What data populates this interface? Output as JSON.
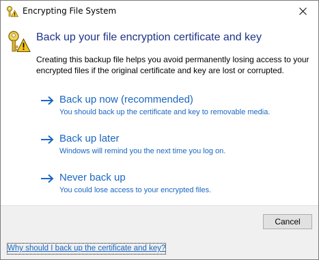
{
  "window": {
    "title": "Encrypting File System",
    "icon": "key-warning-icon"
  },
  "header": {
    "title": "Back up your file encryption certificate and key",
    "description": "Creating this backup file helps you avoid permanently losing access to your encrypted files if the original certificate and key are lost or corrupted."
  },
  "options": [
    {
      "title": "Back up now (recommended)",
      "subtitle": "You should back up the certificate and key to removable media."
    },
    {
      "title": "Back up later",
      "subtitle": "Windows will remind you the next time you log on."
    },
    {
      "title": "Never back up",
      "subtitle": "You could lose access to your encrypted files."
    }
  ],
  "footer": {
    "cancel_label": "Cancel",
    "help_link": "Why should I back up the certificate and key?"
  },
  "colors": {
    "heading": "#1e3287",
    "link": "#1a66c1",
    "footer_bg": "#f0f0f0"
  }
}
